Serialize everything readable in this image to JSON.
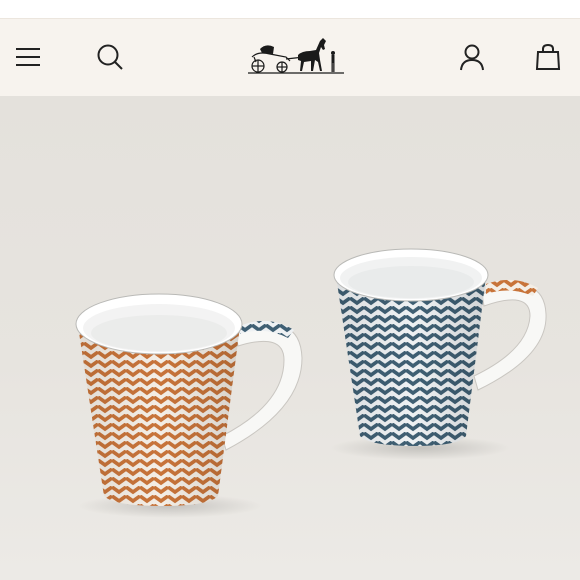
{
  "header": {
    "menu_icon": "hamburger-menu-icon",
    "search_icon": "search-icon",
    "logo_icon": "horse-carriage-logo-icon",
    "account_icon": "account-icon",
    "bag_icon": "shopping-bag-icon"
  },
  "colors": {
    "header_bg": "#f7f3ee",
    "hero_bg": "#e6e3de",
    "mug_orange": "#c8743a",
    "mug_blue": "#3f5f73",
    "icon": "#222222"
  }
}
